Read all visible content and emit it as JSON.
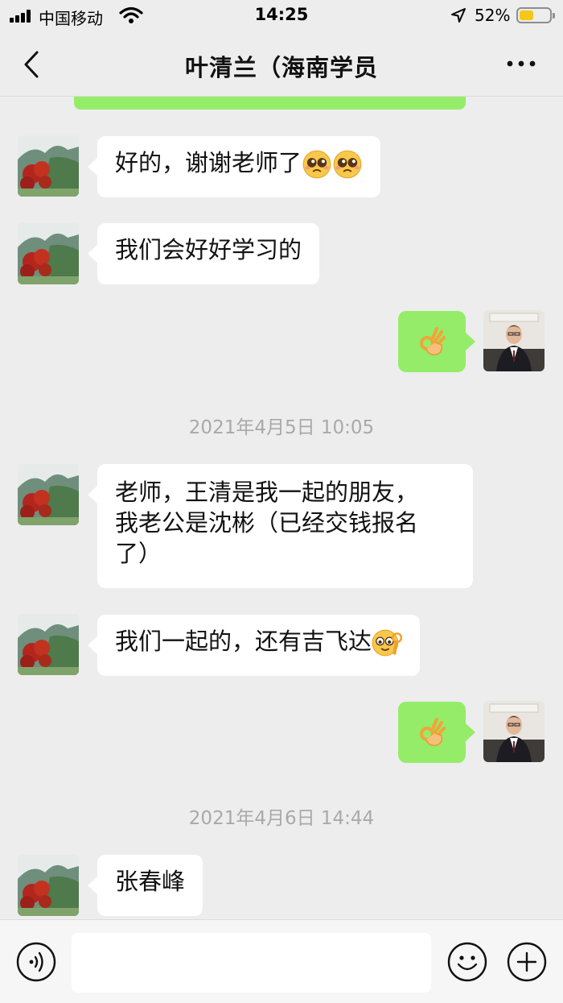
{
  "status_bar": {
    "carrier": "中国移动",
    "time": "14:25",
    "battery_percent": "52%",
    "battery_level": 0.52
  },
  "header": {
    "title": "叶清兰（海南学员"
  },
  "messages": [
    {
      "side": "in",
      "text": "好的，谢谢老师了",
      "emojis": [
        "pleading-face",
        "pleading-face"
      ]
    },
    {
      "side": "in",
      "text": "我们会好好学习的"
    },
    {
      "side": "out",
      "emojis": [
        "ok-hand"
      ]
    },
    {
      "timestamp": "2021年4月5日 10:05"
    },
    {
      "side": "in",
      "lines": [
        "老师，王清是我一起的朋友，",
        "我老公是沈彬（已经交钱报名",
        "了）"
      ]
    },
    {
      "side": "in",
      "text": "我们一起的，还有吉飞达",
      "emojis": [
        "ok-face"
      ]
    },
    {
      "side": "out",
      "emojis": [
        "ok-hand"
      ]
    },
    {
      "timestamp": "2021年4月6日 14:44"
    },
    {
      "side": "in",
      "text": "张春峰"
    }
  ],
  "input_bar": {
    "placeholder": "",
    "icons": [
      "voice-icon",
      "emoji-icon",
      "plus-icon"
    ]
  },
  "colors": {
    "background": "#ededed",
    "outgoing_bubble": "#95ec69",
    "incoming_bubble": "#ffffff",
    "battery": "#f6c619"
  }
}
